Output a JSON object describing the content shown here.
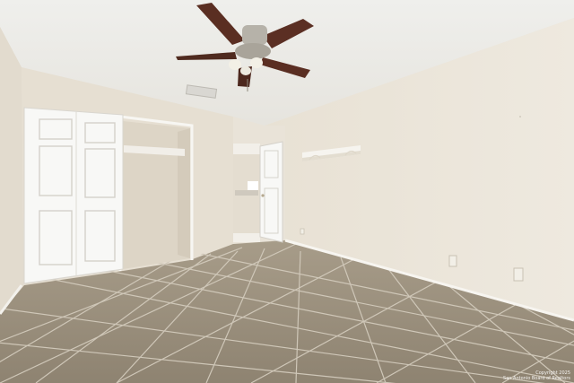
{
  "photo": {
    "subject": "empty bedroom",
    "credit_line_1": "Copyright 2025",
    "credit_line_2": "San Antonio Board of Realtors"
  },
  "colors": {
    "ceiling": "#ecebe7",
    "wall_left": "#e6dfd2",
    "wall_right": "#ebe5da",
    "wall_back": "#e9e3d8",
    "floor": "#9a8f7e",
    "grout": "#c9c1b3",
    "door": "#f7f7f5",
    "fan_blade": "#5a2e22"
  }
}
